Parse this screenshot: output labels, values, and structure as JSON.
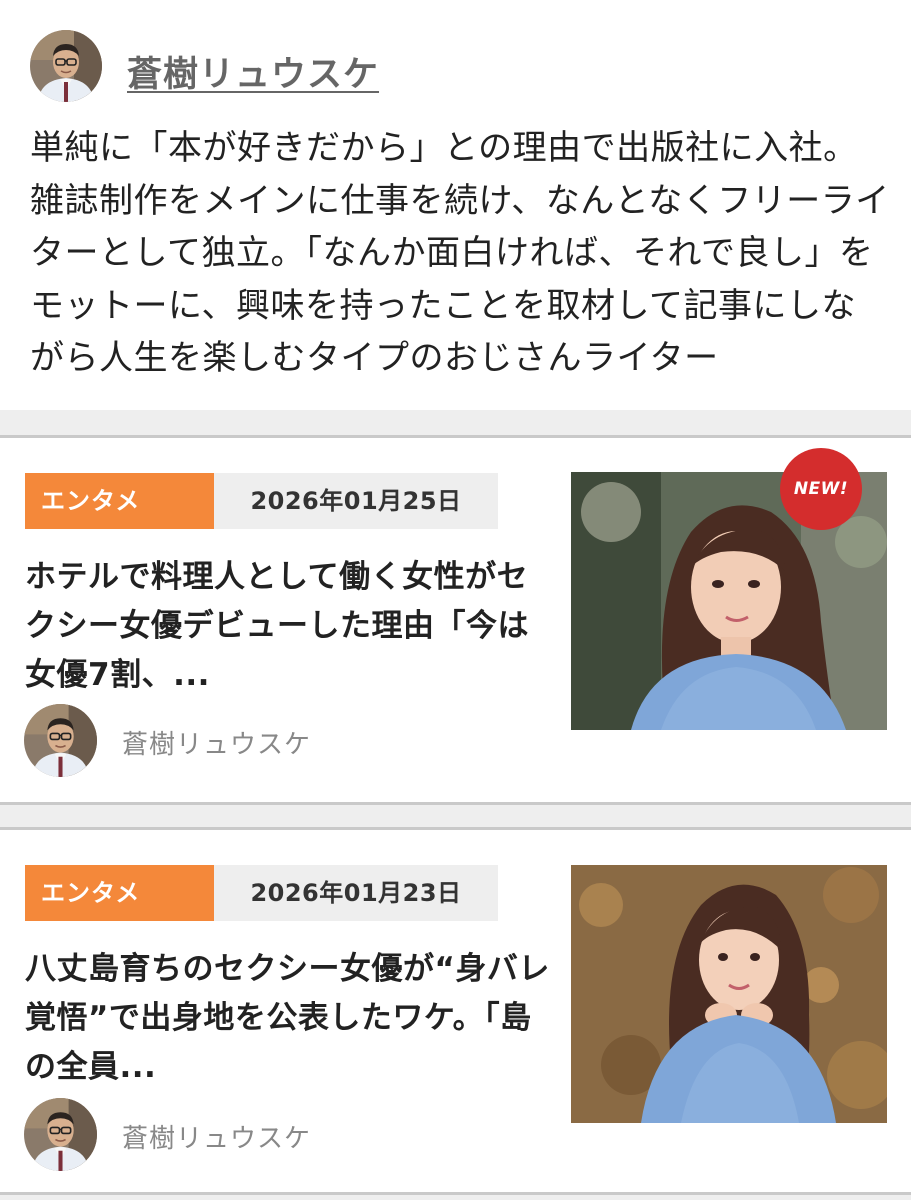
{
  "author": {
    "name": "蒼樹リュウスケ",
    "bio": "単純に「本が好きだから」との理由で出版社に入社。雑誌制作をメインに仕事を続け、なんとなくフリーライターとして独立。「なんか面白ければ、それで良し」をモットーに、興味を持ったことを取材して記事にしながら人生を楽しむタイプのおじさんライター"
  },
  "articles": [
    {
      "category": "エンタメ",
      "date": "2026年01月25日",
      "title": "ホテルで料理人として働く女性がセクシー女優デビューした理由「今は女優7割、...",
      "author": "蒼樹リュウスケ",
      "badge": "NEW!"
    },
    {
      "category": "エンタメ",
      "date": "2026年01月23日",
      "title": "八丈島育ちのセクシー女優が“身バレ覚悟”で出身地を公表したワケ。「島の全員...",
      "author": "蒼樹リュウスケ"
    }
  ],
  "colors": {
    "category_badge": "#f4883a",
    "new_badge": "#d42d2d",
    "separator": "#eeeeee"
  }
}
